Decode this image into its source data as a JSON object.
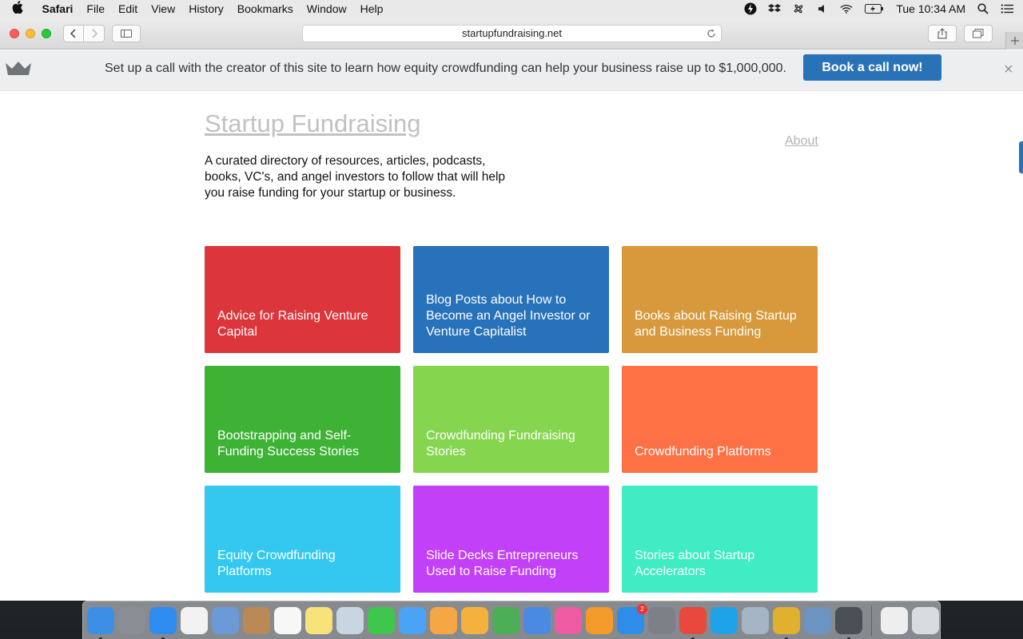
{
  "menubar": {
    "app_name": "Safari",
    "items": [
      "File",
      "Edit",
      "View",
      "History",
      "Bookmarks",
      "Window",
      "Help"
    ],
    "clock": "Tue 10:34 AM"
  },
  "browser": {
    "url": "startupfundraising.net"
  },
  "banner": {
    "message": "Set up a call with the creator of this site to learn how equity crowdfunding can help your business raise up to $1,000,000.",
    "cta_label": "Book a call now!",
    "close_label": "×",
    "cta_color": "#2a72b8"
  },
  "site": {
    "title": "Startup Fundraising",
    "about_label": "About",
    "intro": "A curated directory of resources, articles, podcasts, books, VC's, and angel investors to follow that will help you raise funding for your startup or business."
  },
  "tiles": [
    {
      "label": "Advice for Raising Venture Capital",
      "color": "#dc353b"
    },
    {
      "label": "Blog Posts about How to Become an Angel Investor or Venture Capitalist",
      "color": "#2772ba"
    },
    {
      "label": "Books about Raising Startup and Business Funding",
      "color": "#d8993c"
    },
    {
      "label": "Bootstrapping and Self-Funding Success Stories",
      "color": "#3db234"
    },
    {
      "label": "Crowdfunding Fundraising Stories",
      "color": "#85d54f"
    },
    {
      "label": "Crowdfunding Platforms",
      "color": "#fd7144"
    },
    {
      "label": "Equity Crowdfunding Platforms",
      "color": "#34c8f0"
    },
    {
      "label": "Slide Decks Entrepreneurs Used to Raise Funding",
      "color": "#c140f8"
    },
    {
      "label": "Stories about Startup Accelerators",
      "color": "#3fecc4"
    }
  ],
  "dock": {
    "apps": [
      {
        "icon": "finder-icon",
        "color": "#3d8fe6",
        "running": true
      },
      {
        "icon": "launchpad-icon",
        "color": "#8a8f96",
        "running": false
      },
      {
        "icon": "safari-icon",
        "color": "#2f8cf0",
        "running": true
      },
      {
        "icon": "app-grid-icon",
        "color": "#f2f2f2",
        "running": false
      },
      {
        "icon": "mail-icon",
        "color": "#6b9ad6",
        "running": false
      },
      {
        "icon": "contacts-icon",
        "color": "#b98a55",
        "running": false
      },
      {
        "icon": "calendar-icon",
        "color": "#f7f7f7",
        "running": false
      },
      {
        "icon": "notes-icon",
        "color": "#f8e27a",
        "running": false
      },
      {
        "icon": "preview-icon",
        "color": "#c9d6e2",
        "running": false
      },
      {
        "icon": "facetime-icon",
        "color": "#3fc64d",
        "running": false
      },
      {
        "icon": "messages-icon",
        "color": "#4aa3f5",
        "running": false
      },
      {
        "icon": "photos-icon",
        "color": "#f4a742",
        "running": false
      },
      {
        "icon": "pages-icon",
        "color": "#f5b13e",
        "running": false
      },
      {
        "icon": "numbers-icon",
        "color": "#4cae55",
        "running": false
      },
      {
        "icon": "keynote-icon",
        "color": "#4a8ae3",
        "running": false
      },
      {
        "icon": "itunes-icon",
        "color": "#f05ca3",
        "running": false
      },
      {
        "icon": "ibooks-icon",
        "color": "#f39a2b",
        "running": false
      },
      {
        "icon": "app-store-icon",
        "color": "#2f8de9",
        "running": false,
        "badge": "2"
      },
      {
        "icon": "system-preferences-icon",
        "color": "#7d8187",
        "running": false
      },
      {
        "icon": "chrome-icon",
        "color": "#e8493c",
        "running": true
      },
      {
        "icon": "skype-icon",
        "color": "#1fa3e8",
        "running": false
      },
      {
        "icon": "file-sharing-icon",
        "color": "#a5b4c4",
        "running": false
      },
      {
        "icon": "audacity-icon",
        "color": "#e2b02f",
        "running": true
      },
      {
        "icon": "network-utility-icon",
        "color": "#6d93c1",
        "running": false
      },
      {
        "icon": "sublime-text-icon",
        "color": "#4a4e55",
        "running": true
      }
    ],
    "trailing": [
      {
        "icon": "documents-stack-icon",
        "color": "#eeeeee"
      },
      {
        "icon": "trash-icon",
        "color": "#d9dcdf"
      }
    ]
  }
}
